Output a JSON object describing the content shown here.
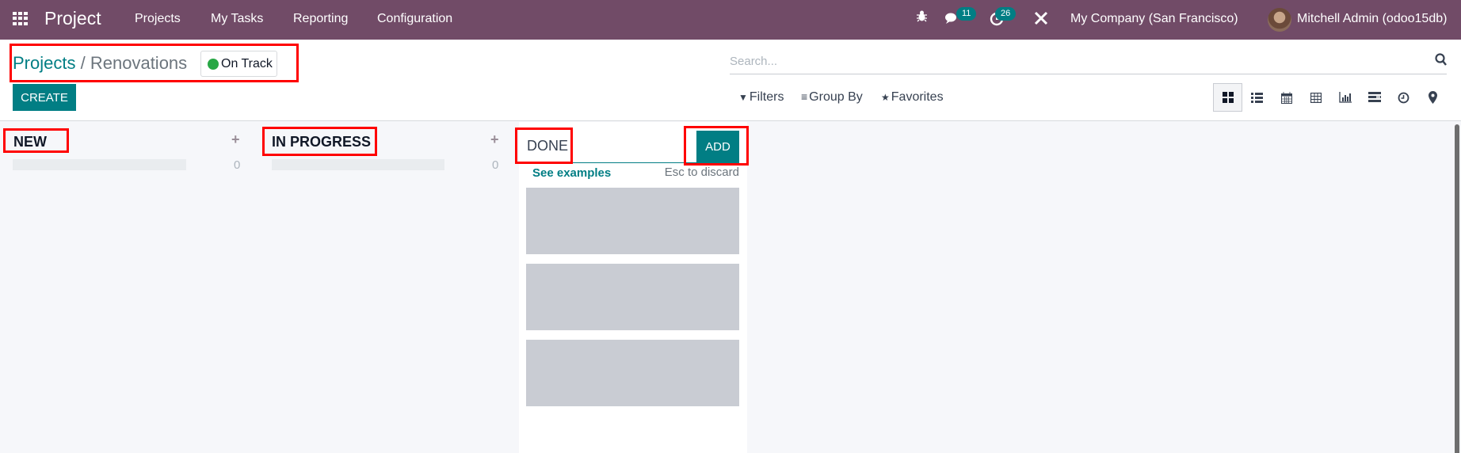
{
  "navbar": {
    "app_icon": "apps-grid-icon",
    "brand": "Project",
    "menu": [
      "Projects",
      "My Tasks",
      "Reporting",
      "Configuration"
    ],
    "icons": {
      "debug": "bug-icon",
      "messages": "chat-icon",
      "activities": "clock-icon",
      "settings": "tools-icon"
    },
    "messages_badge": "11",
    "activities_badge": "26",
    "company": "My Company (San Francisco)",
    "user": "Mitchell Admin (odoo15db)"
  },
  "control_panel": {
    "breadcrumb": {
      "parent": "Projects",
      "separator": "/",
      "current": "Renovations"
    },
    "status": {
      "label": "On Track",
      "color": "#28a745"
    },
    "create_label": "CREATE",
    "search_placeholder": "Search...",
    "filters_label": "Filters",
    "group_by_label": "Group By",
    "favorites_label": "Favorites",
    "views": [
      {
        "name": "kanban",
        "icon": "kanban-icon",
        "active": true
      },
      {
        "name": "list",
        "icon": "list-icon",
        "active": false
      },
      {
        "name": "calendar",
        "icon": "calendar-icon",
        "active": false
      },
      {
        "name": "pivot",
        "icon": "table-icon",
        "active": false
      },
      {
        "name": "graph",
        "icon": "bar-chart-icon",
        "active": false
      },
      {
        "name": "gantt",
        "icon": "gantt-icon",
        "active": false
      },
      {
        "name": "activity",
        "icon": "clock-icon",
        "active": false
      },
      {
        "name": "map",
        "icon": "map-pin-icon",
        "active": false
      }
    ]
  },
  "kanban": {
    "columns": [
      {
        "title": "NEW",
        "count": "0"
      },
      {
        "title": "IN PROGRESS",
        "count": "0"
      }
    ],
    "quick_create": {
      "value": "DONE",
      "add_label": "ADD",
      "see_examples": "See examples",
      "esc_hint": "Esc to discard"
    }
  },
  "colors": {
    "navbar": "#714b67",
    "primary": "#017e84",
    "highlight": "#ff0000"
  }
}
